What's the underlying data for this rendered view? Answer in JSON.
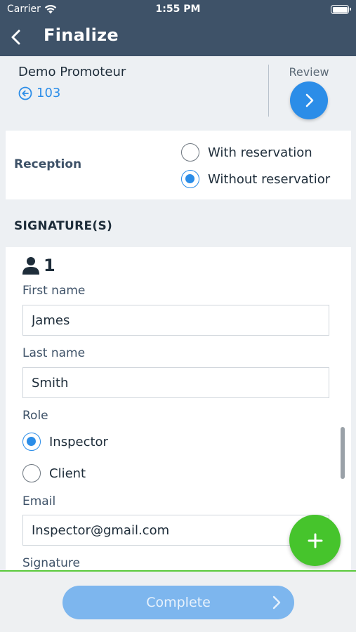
{
  "status_bar": {
    "carrier": "Carrier",
    "time": "1:55 PM"
  },
  "nav": {
    "title": "Finalize"
  },
  "project": {
    "name": "Demo Promoteur",
    "reference": "103",
    "review_label": "Review"
  },
  "reception": {
    "label": "Reception",
    "options": [
      {
        "label": "With reservation",
        "selected": false
      },
      {
        "label": "Without reservatior",
        "selected": true
      }
    ]
  },
  "signatures": {
    "section_title": "SIGNATURE(S)",
    "signer": {
      "number": "1",
      "first_name_label": "First name",
      "first_name_value": "James",
      "last_name_label": "Last name",
      "last_name_value": "Smith",
      "role_label": "Role",
      "roles": [
        {
          "label": "Inspector",
          "selected": true
        },
        {
          "label": "Client",
          "selected": false
        }
      ],
      "email_label": "Email",
      "email_value": "Inspector@gmail.com",
      "signature_label": "Signature"
    }
  },
  "actions": {
    "complete_label": "Complete",
    "add_icon": "plus-icon"
  },
  "colors": {
    "header": "#3e5268",
    "accent": "#2b8de8",
    "add": "#46c42c",
    "complete": "#7db6ee"
  }
}
